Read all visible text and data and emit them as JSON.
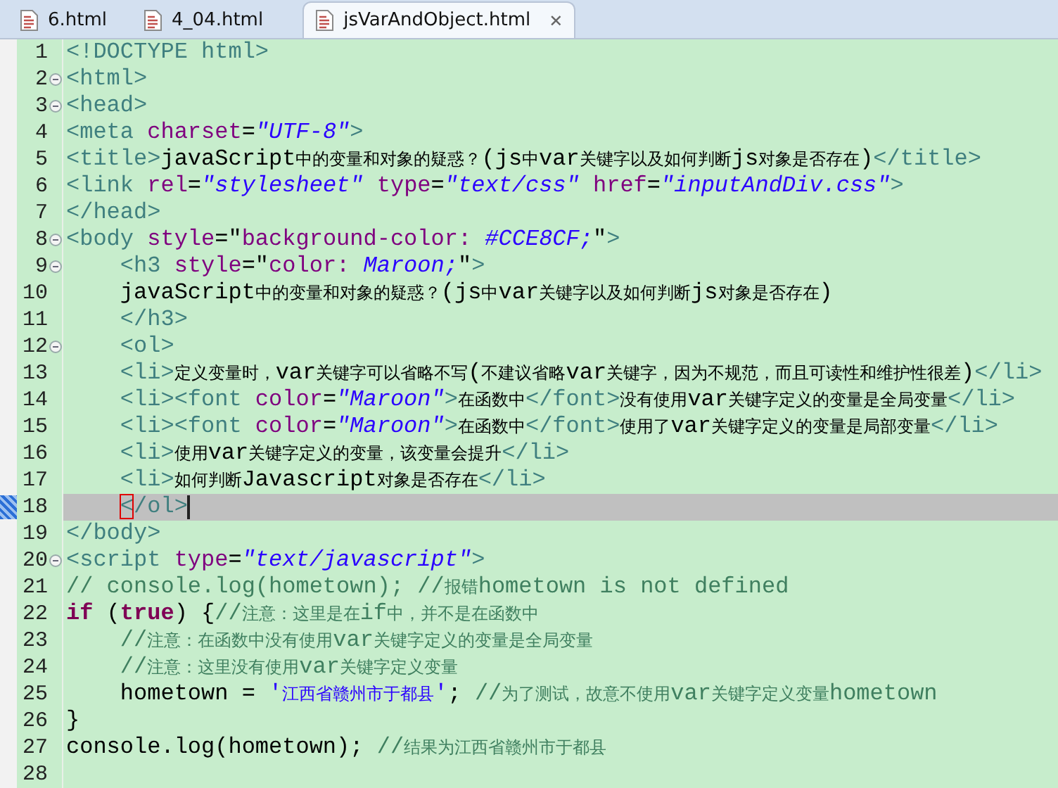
{
  "tabs": [
    {
      "label": "6.html",
      "selected": false
    },
    {
      "label": "4_04.html",
      "selected": false
    },
    {
      "label": "jsVarAndObject.html",
      "selected": true,
      "close": "✕"
    }
  ],
  "lines": [
    {
      "number": "1",
      "fold": false,
      "current": false,
      "tokens": [
        {
          "kind": "tag",
          "text": "<!DOCTYPE html>"
        }
      ]
    },
    {
      "number": "2",
      "fold": true,
      "current": false,
      "tokens": [
        {
          "kind": "tag",
          "text": "<html>"
        }
      ]
    },
    {
      "number": "3",
      "fold": true,
      "current": false,
      "tokens": [
        {
          "kind": "tag",
          "text": "<head>"
        }
      ]
    },
    {
      "number": "4",
      "fold": false,
      "current": false,
      "tokens": [
        {
          "kind": "tag",
          "text": "<meta "
        },
        {
          "kind": "attr",
          "text": "charset"
        },
        {
          "kind": "text",
          "text": "="
        },
        {
          "kind": "string",
          "text": "\"UTF-8\""
        },
        {
          "kind": "tag",
          "text": ">"
        }
      ]
    },
    {
      "number": "5",
      "fold": false,
      "current": false,
      "tokens": [
        {
          "kind": "tag",
          "text": "<title>"
        },
        {
          "kind": "text",
          "text": "javaScript中的变量和对象的疑惑？(js中var关键字以及如何判断js对象是否存在)"
        },
        {
          "kind": "tag",
          "text": "</title>"
        }
      ]
    },
    {
      "number": "6",
      "fold": false,
      "current": false,
      "tokens": [
        {
          "kind": "tag",
          "text": "<link "
        },
        {
          "kind": "attr",
          "text": "rel"
        },
        {
          "kind": "text",
          "text": "="
        },
        {
          "kind": "string",
          "text": "\"stylesheet\" "
        },
        {
          "kind": "attr",
          "text": "type"
        },
        {
          "kind": "text",
          "text": "="
        },
        {
          "kind": "string",
          "text": "\"text/css\" "
        },
        {
          "kind": "attr",
          "text": "href"
        },
        {
          "kind": "text",
          "text": "="
        },
        {
          "kind": "string",
          "text": "\"inputAndDiv.css\""
        },
        {
          "kind": "tag",
          "text": ">"
        }
      ]
    },
    {
      "number": "7",
      "fold": false,
      "current": false,
      "tokens": [
        {
          "kind": "tag",
          "text": "</head>"
        }
      ]
    },
    {
      "number": "8",
      "fold": true,
      "current": false,
      "tokens": [
        {
          "kind": "tag",
          "text": "<body "
        },
        {
          "kind": "attr",
          "text": "style"
        },
        {
          "kind": "text",
          "text": "=\""
        },
        {
          "kind": "attr",
          "text": "background-color: "
        },
        {
          "kind": "string",
          "text": "#CCE8CF;"
        },
        {
          "kind": "text",
          "text": "\""
        },
        {
          "kind": "tag",
          "text": ">"
        }
      ]
    },
    {
      "number": "9",
      "fold": true,
      "current": false,
      "tokens": [
        {
          "kind": "tag",
          "text": "    <h3 "
        },
        {
          "kind": "attr",
          "text": "style"
        },
        {
          "kind": "text",
          "text": "=\""
        },
        {
          "kind": "attr",
          "text": "color: "
        },
        {
          "kind": "string",
          "text": "Maroon;"
        },
        {
          "kind": "text",
          "text": "\""
        },
        {
          "kind": "tag",
          "text": ">"
        }
      ]
    },
    {
      "number": "10",
      "fold": false,
      "current": false,
      "tokens": [
        {
          "kind": "text",
          "text": "    javaScript中的变量和对象的疑惑？(js中var关键字以及如何判断js对象是否存在)"
        }
      ]
    },
    {
      "number": "11",
      "fold": false,
      "current": false,
      "tokens": [
        {
          "kind": "tag",
          "text": "    </h3>"
        }
      ]
    },
    {
      "number": "12",
      "fold": true,
      "current": false,
      "tokens": [
        {
          "kind": "tag",
          "text": "    <ol>"
        }
      ]
    },
    {
      "number": "13",
      "fold": false,
      "current": false,
      "tokens": [
        {
          "kind": "tag",
          "text": "    <li>"
        },
        {
          "kind": "text",
          "text": "定义变量时，var关键字可以省略不写(不建议省略var关键字，因为不规范，而且可读性和维护性很差)"
        },
        {
          "kind": "tag",
          "text": "</li>"
        }
      ]
    },
    {
      "number": "14",
      "fold": false,
      "current": false,
      "tokens": [
        {
          "kind": "tag",
          "text": "    <li><font "
        },
        {
          "kind": "attr",
          "text": "color"
        },
        {
          "kind": "text",
          "text": "="
        },
        {
          "kind": "string",
          "text": "\"Maroon\""
        },
        {
          "kind": "tag",
          "text": ">"
        },
        {
          "kind": "text",
          "text": "在函数中"
        },
        {
          "kind": "tag",
          "text": "</font>"
        },
        {
          "kind": "text",
          "text": "没有使用var关键字定义的变量是全局变量"
        },
        {
          "kind": "tag",
          "text": "</li>"
        }
      ]
    },
    {
      "number": "15",
      "fold": false,
      "current": false,
      "tokens": [
        {
          "kind": "tag",
          "text": "    <li><font "
        },
        {
          "kind": "attr",
          "text": "color"
        },
        {
          "kind": "text",
          "text": "="
        },
        {
          "kind": "string",
          "text": "\"Maroon\""
        },
        {
          "kind": "tag",
          "text": ">"
        },
        {
          "kind": "text",
          "text": "在函数中"
        },
        {
          "kind": "tag",
          "text": "</font>"
        },
        {
          "kind": "text",
          "text": "使用了var关键字定义的变量是局部变量"
        },
        {
          "kind": "tag",
          "text": "</li>"
        }
      ]
    },
    {
      "number": "16",
      "fold": false,
      "current": false,
      "tokens": [
        {
          "kind": "tag",
          "text": "    <li>"
        },
        {
          "kind": "text",
          "text": "使用var关键字定义的变量，该变量会提升"
        },
        {
          "kind": "tag",
          "text": "</li>"
        }
      ]
    },
    {
      "number": "17",
      "fold": false,
      "current": false,
      "tokens": [
        {
          "kind": "tag",
          "text": "    <li>"
        },
        {
          "kind": "text",
          "text": "如何判断Javascript对象是否存在"
        },
        {
          "kind": "tag",
          "text": "</li>"
        }
      ]
    },
    {
      "number": "18",
      "fold": false,
      "current": true,
      "cursor": true,
      "indented": true,
      "tokens": [
        {
          "kind": "tag",
          "text": "<",
          "matched": true
        },
        {
          "kind": "tag",
          "text": "/ol>"
        }
      ]
    },
    {
      "number": "19",
      "fold": false,
      "current": false,
      "tokens": [
        {
          "kind": "tag",
          "text": "</body>"
        }
      ]
    },
    {
      "number": "20",
      "fold": true,
      "current": false,
      "tokens": [
        {
          "kind": "tag",
          "text": "<script "
        },
        {
          "kind": "attr",
          "text": "type"
        },
        {
          "kind": "text",
          "text": "="
        },
        {
          "kind": "string",
          "text": "\"text/javascript\""
        },
        {
          "kind": "tag",
          "text": ">"
        }
      ]
    },
    {
      "number": "21",
      "fold": false,
      "current": false,
      "tokens": [
        {
          "kind": "comment",
          "text": "// console.log(hometown); //报错hometown is not defined"
        }
      ]
    },
    {
      "number": "22",
      "fold": false,
      "current": false,
      "tokens": [
        {
          "kind": "keyword",
          "text": "if"
        },
        {
          "kind": "text",
          "text": " ("
        },
        {
          "kind": "keyword",
          "text": "true"
        },
        {
          "kind": "text",
          "text": ") {"
        },
        {
          "kind": "comment",
          "text": "//注意：这里是在if中，并不是在函数中"
        }
      ]
    },
    {
      "number": "23",
      "fold": false,
      "current": false,
      "tokens": [
        {
          "kind": "comment",
          "text": "    //注意：在函数中没有使用var关键字定义的变量是全局变量"
        }
      ]
    },
    {
      "number": "24",
      "fold": false,
      "current": false,
      "tokens": [
        {
          "kind": "comment",
          "text": "    //注意：这里没有使用var关键字定义变量"
        }
      ]
    },
    {
      "number": "25",
      "fold": false,
      "current": false,
      "tokens": [
        {
          "kind": "text",
          "text": "    hometown = "
        },
        {
          "kind": "jsstring",
          "text": "'江西省赣州市于都县'"
        },
        {
          "kind": "text",
          "text": "; "
        },
        {
          "kind": "comment",
          "text": "//为了测试，故意不使用var关键字定义变量hometown"
        }
      ]
    },
    {
      "number": "26",
      "fold": false,
      "current": false,
      "tokens": [
        {
          "kind": "text",
          "text": "}"
        }
      ]
    },
    {
      "number": "27",
      "fold": false,
      "current": false,
      "tokens": [
        {
          "kind": "text",
          "text": "console.log(hometown); "
        },
        {
          "kind": "comment",
          "text": "//结果为江西省赣州市于都县"
        }
      ]
    },
    {
      "number": "28",
      "fold": false,
      "current": false
    }
  ]
}
